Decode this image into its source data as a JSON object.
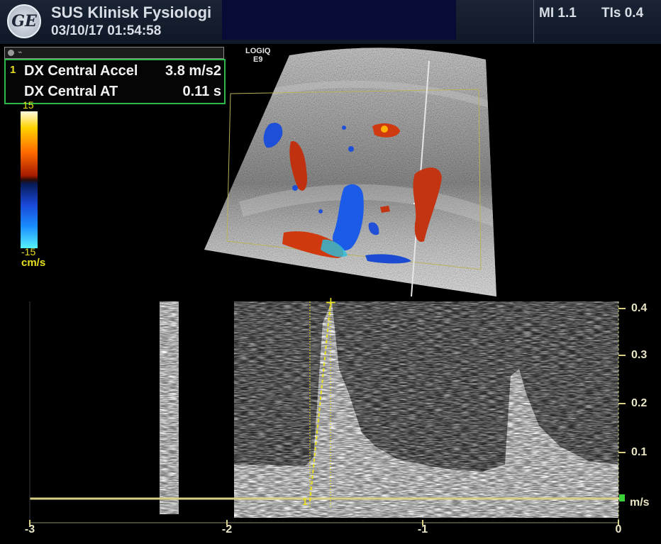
{
  "header": {
    "logo_text": "GE",
    "organization": "SUS Klinisk Fysiologi",
    "datetime": "03/10/17 01:54:58",
    "mi": "MI 1.1",
    "tis": "TIs 0.4"
  },
  "measurements": [
    {
      "index": "1",
      "label": "DX Central Accel",
      "value": "3.8 m/s2"
    },
    {
      "index": "",
      "label": "DX Central AT",
      "value": "0.11 s"
    }
  ],
  "color_scale": {
    "top": "15",
    "bottom": "-15",
    "unit": "cm/s"
  },
  "scanner": {
    "model": "LOGIQ",
    "sub": "E9"
  },
  "spectral": {
    "y_ticks": [
      "0.4",
      "0.3",
      "0.2",
      "0.1"
    ],
    "y_unit": "m/s",
    "x_ticks": [
      "-3",
      "-2",
      "-1",
      "0"
    ],
    "cursor_marker": "1"
  },
  "colors": {
    "measure_border": "#2fb84a",
    "annotation_yellow": "#e8e020",
    "baseline": "#d8d080"
  }
}
